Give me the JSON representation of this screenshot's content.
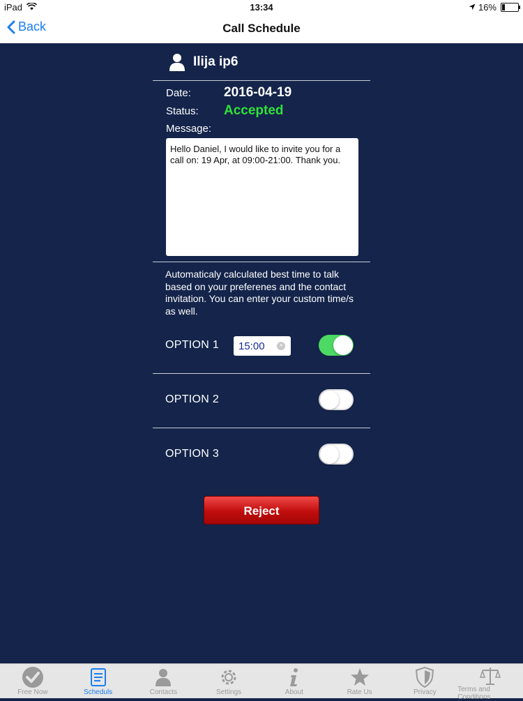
{
  "status_bar": {
    "device": "iPad",
    "time": "13:34",
    "battery": "16%",
    "battery_level": 0.16
  },
  "nav": {
    "back_label": "Back",
    "title": "Call Schedule"
  },
  "contact": {
    "name": "Ilija ip6"
  },
  "details": {
    "date_label": "Date:",
    "date_value": "2016-04-19",
    "status_label": "Status:",
    "status_value": "Accepted",
    "message_label": "Message:",
    "message_text": "Hello Daniel, I would like to invite you for a call on: 19 Apr, at 09:00-21:00. Thank you."
  },
  "hint": "Automaticaly calculated best time to talk based on your preferenes and the contact invitation. You can enter your custom time/s as well.",
  "options": [
    {
      "label": "OPTION 1",
      "time": "15:00",
      "enabled": true
    },
    {
      "label": "OPTION 2",
      "enabled": false
    },
    {
      "label": "OPTION 3",
      "enabled": false
    }
  ],
  "reject_label": "Reject",
  "tabs": [
    {
      "label": "Free Now",
      "icon": "check-circle-icon"
    },
    {
      "label": "Scheduls",
      "icon": "schedule-doc-icon",
      "active": true
    },
    {
      "label": "Contacts",
      "icon": "person-icon"
    },
    {
      "label": "Settings",
      "icon": "gear-icon"
    },
    {
      "label": "About",
      "icon": "info-icon"
    },
    {
      "label": "Rate Us",
      "icon": "star-icon"
    },
    {
      "label": "Privacy",
      "icon": "shield-icon"
    },
    {
      "label": "Terms and Conditions",
      "icon": "scales-icon"
    }
  ],
  "colors": {
    "background": "#14244a",
    "accent": "#1a7ef0",
    "status_accepted": "#2fe03a",
    "toggle_on": "#4cd964",
    "reject": "#c00d0d"
  }
}
